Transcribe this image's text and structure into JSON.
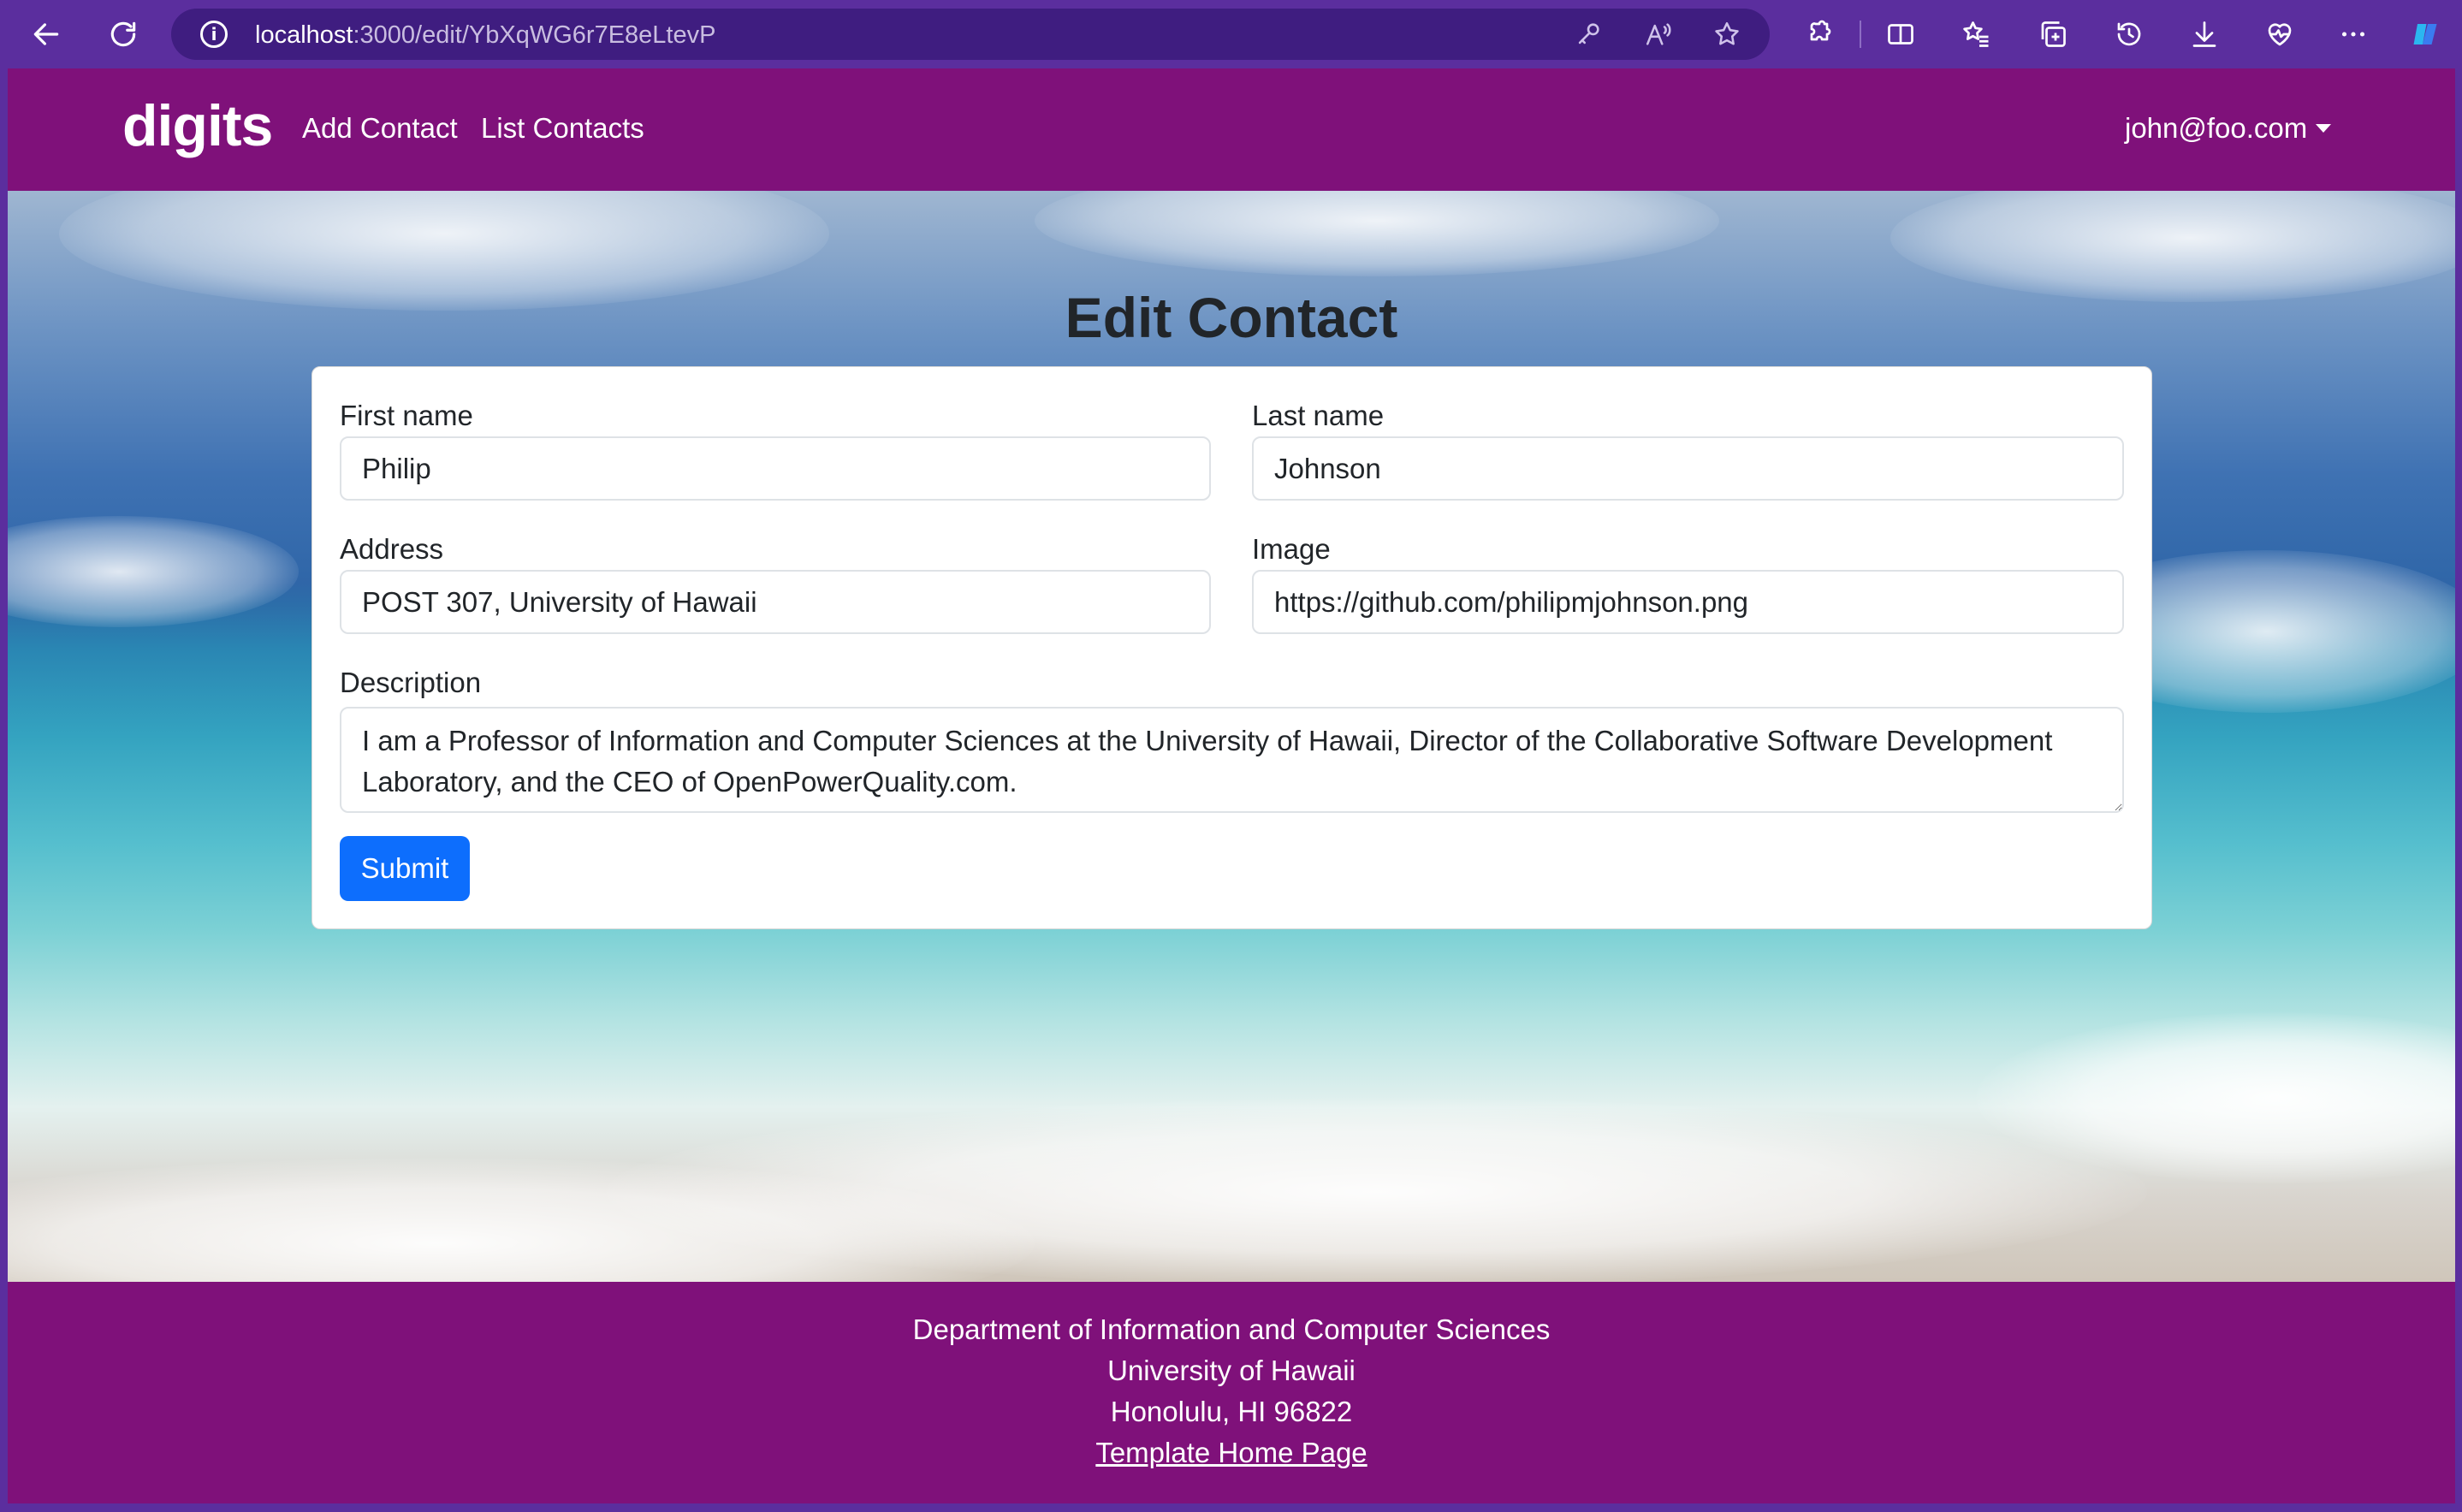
{
  "browser": {
    "url_host": "localhost",
    "url_path": ":3000/edit/YbXqWG6r7E8eLtevP"
  },
  "navbar": {
    "brand": "digits",
    "links": [
      "Add Contact",
      "List Contacts"
    ],
    "user": "john@foo.com"
  },
  "page": {
    "title": "Edit Contact"
  },
  "form": {
    "first_name": {
      "label": "First name",
      "value": "Philip"
    },
    "last_name": {
      "label": "Last name",
      "value": "Johnson"
    },
    "address": {
      "label": "Address",
      "value": "POST 307, University of Hawaii"
    },
    "image": {
      "label": "Image",
      "value": "https://github.com/philipmjohnson.png"
    },
    "description": {
      "label": "Description",
      "value": "I am a Professor of Information and Computer Sciences at the University of Hawaii, Director of the Collaborative Software Development Laboratory, and the CEO of OpenPowerQuality.com."
    },
    "submit_label": "Submit"
  },
  "footer": {
    "line1": "Department of Information and Computer Sciences",
    "line2": "University of Hawaii",
    "line3": "Honolulu, HI 96822",
    "link": "Template Home Page"
  },
  "colors": {
    "chrome": "#5b2e9e",
    "navbar": "#7f117a",
    "primary_button": "#0d6efd"
  }
}
